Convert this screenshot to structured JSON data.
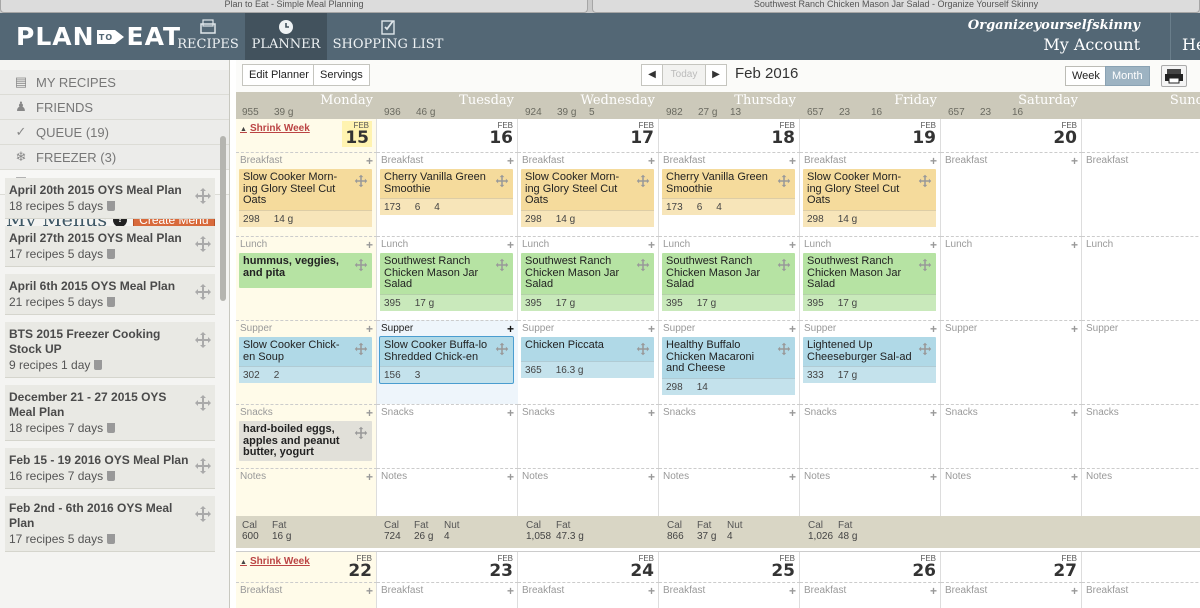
{
  "browser_tabs": [
    {
      "title": "Plan to Eat - Simple Meal Planning"
    },
    {
      "title": "Southwest Ranch Chicken Mason Jar Salad - Organize Yourself Skinny"
    }
  ],
  "logo": {
    "text_left": "PLAN",
    "text_mark": "TO",
    "text_right": "EAT"
  },
  "nav": {
    "recipes": "RECIPES",
    "planner": "PLANNER",
    "shopping": "SHOPPING LIST"
  },
  "account": {
    "username": "Organizeyourselfskinny",
    "label": "My Account"
  },
  "help": "He",
  "sidebar": {
    "items": [
      {
        "label": "MY RECIPES"
      },
      {
        "label": "FRIENDS"
      },
      {
        "label": "QUEUE (19)"
      },
      {
        "label": "FREEZER (3)"
      },
      {
        "label": "MENUS"
      }
    ],
    "my_menus_title": "My Menus",
    "help_glyph": "?",
    "create_menu": "Create Menu",
    "menus": [
      {
        "title": "April 20th 2015 OYS Meal Plan",
        "recipes": "18 recipes",
        "days": "5 days"
      },
      {
        "title": "April 27th 2015 OYS Meal Plan",
        "recipes": "17 recipes",
        "days": "5 days"
      },
      {
        "title": "April 6th 2015 OYS Meal Plan",
        "recipes": "21 recipes",
        "days": "5 days"
      },
      {
        "title": "BTS 2015 Freezer Cooking Stock UP",
        "recipes": "9 recipes",
        "days": "1 day"
      },
      {
        "title": "December 21 - 27 2015 OYS Meal Plan",
        "recipes": "18 recipes",
        "days": "7 days"
      },
      {
        "title": "Feb 15 - 19 2016 OYS Meal Plan",
        "recipes": "16 recipes",
        "days": "7 days"
      },
      {
        "title": "Feb 2nd - 6th 2016 OYS Meal Plan",
        "recipes": "17 recipes",
        "days": "5 days"
      }
    ]
  },
  "toolbar": {
    "edit_planner": "Edit Planner",
    "servings": "Servings",
    "prev": "◀",
    "today": "Today",
    "next": "▶",
    "month_label": "Feb 2016",
    "week": "Week",
    "month": "Month"
  },
  "days": [
    "Monday",
    "Tuesday",
    "Wednesday",
    "Thursday",
    "Friday",
    "Saturday",
    "Sunday"
  ],
  "prev_week_totals": [
    {
      "cal": "955",
      "fat": "39 g",
      "nut": ""
    },
    {
      "cal": "936",
      "fat": "46 g",
      "nut": ""
    },
    {
      "cal": "924",
      "fat": "39 g",
      "nut": "5"
    },
    {
      "cal": "982",
      "fat": "27 g",
      "nut": "13"
    },
    {
      "cal": "657",
      "fat": "23",
      "nut": "16"
    },
    {
      "cal": "657",
      "fat": "23",
      "nut": "16"
    }
  ],
  "week1": {
    "shrink_label": "Shrink Week",
    "dates": [
      {
        "mon": "FEB",
        "num": "15"
      },
      {
        "mon": "FEB",
        "num": "16"
      },
      {
        "mon": "FEB",
        "num": "17"
      },
      {
        "mon": "FEB",
        "num": "18"
      },
      {
        "mon": "FEB",
        "num": "19"
      },
      {
        "mon": "FEB",
        "num": "20"
      },
      {
        "mon": "",
        "num": ""
      }
    ],
    "slot_labels": {
      "breakfast": "Breakfast",
      "lunch": "Lunch",
      "supper": "Supper",
      "snacks": "Snacks",
      "notes": "Notes"
    },
    "plus": "+",
    "breakfast": [
      {
        "title": "Slow Cooker Morn-ing Glory Steel Cut Oats",
        "cal": "298",
        "fat": "14 g",
        "nut": ""
      },
      {
        "title": "Cherry Vanilla Green Smoothie",
        "cal": "173",
        "fat": "6",
        "nut": "4"
      },
      {
        "title": "Slow Cooker Morn-ing Glory Steel Cut Oats",
        "cal": "298",
        "fat": "14 g",
        "nut": ""
      },
      {
        "title": "Cherry Vanilla Green Smoothie",
        "cal": "173",
        "fat": "6",
        "nut": "4"
      },
      {
        "title": "Slow Cooker Morn-ing Glory Steel Cut Oats",
        "cal": "298",
        "fat": "14 g",
        "nut": ""
      }
    ],
    "lunch": [
      {
        "title": "hummus, veggies, and pita"
      },
      {
        "title": "Southwest Ranch Chicken Mason Jar Salad",
        "cal": "395",
        "fat": "17 g",
        "nut": ""
      },
      {
        "title": "Southwest Ranch Chicken Mason Jar Salad",
        "cal": "395",
        "fat": "17 g",
        "nut": ""
      },
      {
        "title": "Southwest Ranch Chicken Mason Jar Salad",
        "cal": "395",
        "fat": "17 g",
        "nut": ""
      },
      {
        "title": "Southwest Ranch Chicken Mason Jar Salad",
        "cal": "395",
        "fat": "17 g",
        "nut": ""
      }
    ],
    "supper": [
      {
        "title": "Slow Cooker Chick-en Soup",
        "cal": "302",
        "fat": "2",
        "nut": ""
      },
      {
        "title": "Slow Cooker Buffa-lo Shredded Chick-en",
        "cal": "156",
        "fat": "3",
        "nut": ""
      },
      {
        "title": "Chicken Piccata",
        "cal": "365",
        "fat": "16.3 g",
        "nut": ""
      },
      {
        "title": "Healthy Buffalo Chicken Macaroni and Cheese",
        "cal": "298",
        "fat": "14",
        "nut": ""
      },
      {
        "title": "Lightened Up Cheeseburger Sal-ad",
        "cal": "333",
        "fat": "17 g",
        "nut": ""
      }
    ],
    "snack": {
      "title": "hard-boiled eggs, apples and peanut butter, yogurt"
    },
    "totals": [
      {
        "h1": "Cal",
        "h2": "Fat",
        "h3": "",
        "v1": "600",
        "v2": "16 g",
        "v3": ""
      },
      {
        "h1": "Cal",
        "h2": "Fat",
        "h3": "Nut",
        "v1": "724",
        "v2": "26 g",
        "v3": "4"
      },
      {
        "h1": "Cal",
        "h2": "Fat",
        "h3": "",
        "v1": "1,058",
        "v2": "47.3 g",
        "v3": ""
      },
      {
        "h1": "Cal",
        "h2": "Fat",
        "h3": "Nut",
        "v1": "866",
        "v2": "37 g",
        "v3": "4"
      },
      {
        "h1": "Cal",
        "h2": "Fat",
        "h3": "",
        "v1": "1,026",
        "v2": "48 g",
        "v3": ""
      }
    ]
  },
  "week2": {
    "shrink_label": "Shrink Week",
    "dates": [
      {
        "mon": "FEB",
        "num": "22"
      },
      {
        "mon": "FEB",
        "num": "23"
      },
      {
        "mon": "FEB",
        "num": "24"
      },
      {
        "mon": "FEB",
        "num": "25"
      },
      {
        "mon": "FEB",
        "num": "26"
      },
      {
        "mon": "FEB",
        "num": "27"
      },
      {
        "mon": "",
        "num": ""
      }
    ],
    "breakfast_label": "Breakfast"
  },
  "colors": {
    "nav_bg": "#536775",
    "create_btn": "#d86a3c",
    "breakfast_card": "#f5db9c",
    "lunch_card": "#b6e3a3",
    "supper_card": "#b0d9e7",
    "snack_card": "#e1e0d9",
    "today_column": "#fffbe9",
    "shrink_link": "#bb4444"
  }
}
